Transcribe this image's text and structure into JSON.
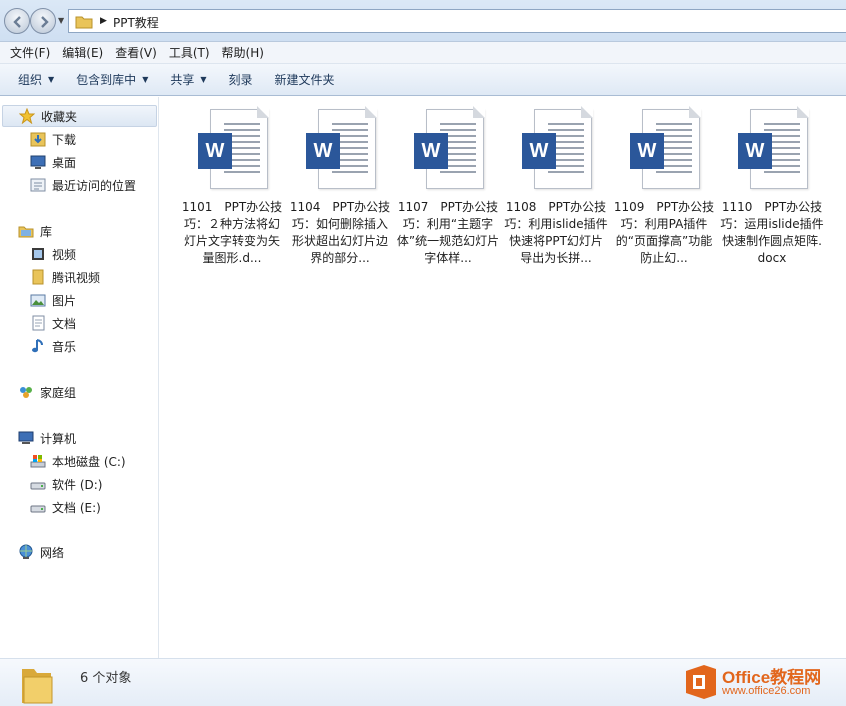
{
  "address": {
    "crumb": "PPT教程"
  },
  "menu": [
    "文件(F)",
    "编辑(E)",
    "查看(V)",
    "工具(T)",
    "帮助(H)"
  ],
  "commands": [
    {
      "label": "组织",
      "dropdown": true
    },
    {
      "label": "包含到库中",
      "dropdown": true
    },
    {
      "label": "共享",
      "dropdown": true
    },
    {
      "label": "刻录",
      "dropdown": false
    },
    {
      "label": "新建文件夹",
      "dropdown": false
    }
  ],
  "sidebar": {
    "favorites": "收藏夹",
    "downloads": "下载",
    "desktop": "桌面",
    "recent": "最近访问的位置",
    "libraries": "库",
    "videos": "视频",
    "tencent_video": "腾讯视频",
    "pictures": "图片",
    "documents": "文档",
    "music": "音乐",
    "homegroup": "家庭组",
    "computer": "计算机",
    "drive_c": "本地磁盘 (C:)",
    "drive_d": "软件 (D:)",
    "drive_e": "文档 (E:)",
    "network": "网络"
  },
  "files": [
    {
      "name": "1101　PPT办公技巧：２种方法将幻灯片文字转变为矢量图形.d..."
    },
    {
      "name": "1104　PPT办公技巧：如何删除插入形状超出幻灯片边界的部分..."
    },
    {
      "name": "1107　PPT办公技巧：利用“主题字体”统一规范幻灯片字体样..."
    },
    {
      "name": "1108　PPT办公技巧：利用islide插件快速将PPT幻灯片导出为长拼..."
    },
    {
      "name": "1109　PPT办公技巧：利用PA插件的“页面撑高”功能防止幻..."
    },
    {
      "name": "1110　PPT办公技巧：运用islide插件快速制作圆点矩阵.docx"
    }
  ],
  "status": {
    "count": "6 个对象"
  },
  "watermark": {
    "title": "Office教程网",
    "url": "www.office26.com"
  },
  "colors": {
    "word_blue": "#2b579a",
    "brand_orange": "#e2661c"
  }
}
